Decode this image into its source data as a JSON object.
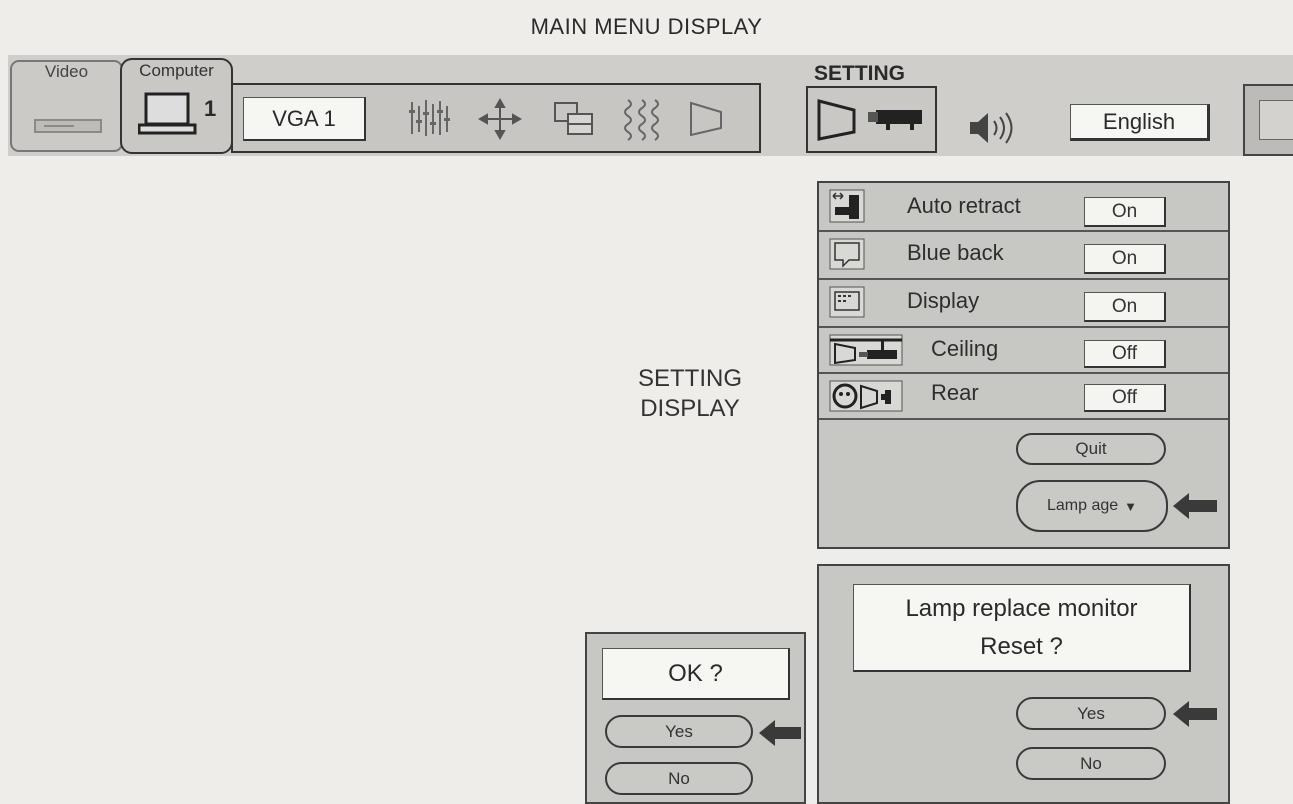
{
  "page_title": "MAIN MENU DISPLAY",
  "menubar": {
    "video_label": "Video",
    "computer_label": "Computer",
    "computer_number": "1",
    "source_field": "VGA 1",
    "setting_label": "SETTING",
    "language": "English",
    "icons": [
      "image-adjust-icon",
      "position-icon",
      "pc-adjust-icon",
      "keystone-icon",
      "screen-icon",
      "setting-screen-icon",
      "projector-icon",
      "sound-icon"
    ]
  },
  "setting_display_caption": [
    "SETTING",
    "DISPLAY"
  ],
  "setting_panel": {
    "rows": [
      {
        "label": "Auto retract",
        "value": "On",
        "icon": "auto-retract-icon"
      },
      {
        "label": "Blue back",
        "value": "On",
        "icon": "blue-back-icon"
      },
      {
        "label": "Display",
        "value": "On",
        "icon": "display-icon"
      },
      {
        "label": "Ceiling",
        "value": "Off",
        "icon": "ceiling-icon"
      },
      {
        "label": "Rear",
        "value": "Off",
        "icon": "rear-icon"
      }
    ],
    "quit_label": "Quit",
    "lamp_age_label": "Lamp age"
  },
  "lamp_dialog": {
    "message_line1": "Lamp replace monitor",
    "message_line2": "Reset ?",
    "yes_label": "Yes",
    "no_label": "No"
  },
  "ok_dialog": {
    "message": "OK ?",
    "yes_label": "Yes",
    "no_label": "No"
  },
  "colors": {
    "background": "#eeede9",
    "panel": "#c7c7c4",
    "border": "#3a3a3a",
    "arrow": "#3a3a3a"
  }
}
